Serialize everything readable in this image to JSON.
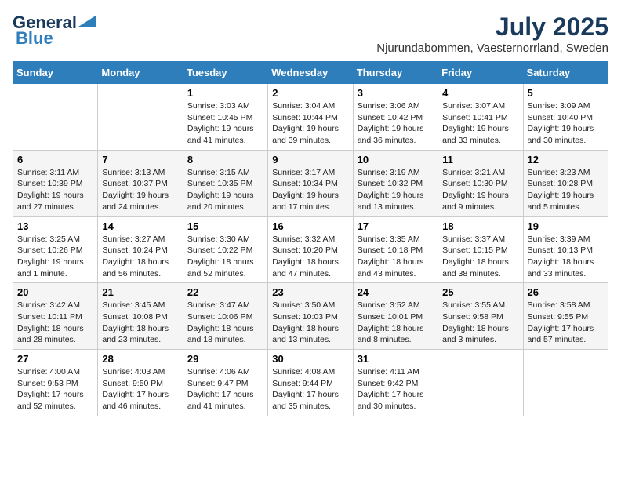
{
  "header": {
    "logo_general": "General",
    "logo_blue": "Blue",
    "month": "July 2025",
    "location": "Njurundabommen, Vaesternorrland, Sweden"
  },
  "days_of_week": [
    "Sunday",
    "Monday",
    "Tuesday",
    "Wednesday",
    "Thursday",
    "Friday",
    "Saturday"
  ],
  "weeks": [
    [
      {
        "day": "",
        "info": ""
      },
      {
        "day": "",
        "info": ""
      },
      {
        "day": "1",
        "info": "Sunrise: 3:03 AM\nSunset: 10:45 PM\nDaylight: 19 hours and 41 minutes."
      },
      {
        "day": "2",
        "info": "Sunrise: 3:04 AM\nSunset: 10:44 PM\nDaylight: 19 hours and 39 minutes."
      },
      {
        "day": "3",
        "info": "Sunrise: 3:06 AM\nSunset: 10:42 PM\nDaylight: 19 hours and 36 minutes."
      },
      {
        "day": "4",
        "info": "Sunrise: 3:07 AM\nSunset: 10:41 PM\nDaylight: 19 hours and 33 minutes."
      },
      {
        "day": "5",
        "info": "Sunrise: 3:09 AM\nSunset: 10:40 PM\nDaylight: 19 hours and 30 minutes."
      }
    ],
    [
      {
        "day": "6",
        "info": "Sunrise: 3:11 AM\nSunset: 10:39 PM\nDaylight: 19 hours and 27 minutes."
      },
      {
        "day": "7",
        "info": "Sunrise: 3:13 AM\nSunset: 10:37 PM\nDaylight: 19 hours and 24 minutes."
      },
      {
        "day": "8",
        "info": "Sunrise: 3:15 AM\nSunset: 10:35 PM\nDaylight: 19 hours and 20 minutes."
      },
      {
        "day": "9",
        "info": "Sunrise: 3:17 AM\nSunset: 10:34 PM\nDaylight: 19 hours and 17 minutes."
      },
      {
        "day": "10",
        "info": "Sunrise: 3:19 AM\nSunset: 10:32 PM\nDaylight: 19 hours and 13 minutes."
      },
      {
        "day": "11",
        "info": "Sunrise: 3:21 AM\nSunset: 10:30 PM\nDaylight: 19 hours and 9 minutes."
      },
      {
        "day": "12",
        "info": "Sunrise: 3:23 AM\nSunset: 10:28 PM\nDaylight: 19 hours and 5 minutes."
      }
    ],
    [
      {
        "day": "13",
        "info": "Sunrise: 3:25 AM\nSunset: 10:26 PM\nDaylight: 19 hours and 1 minute."
      },
      {
        "day": "14",
        "info": "Sunrise: 3:27 AM\nSunset: 10:24 PM\nDaylight: 18 hours and 56 minutes."
      },
      {
        "day": "15",
        "info": "Sunrise: 3:30 AM\nSunset: 10:22 PM\nDaylight: 18 hours and 52 minutes."
      },
      {
        "day": "16",
        "info": "Sunrise: 3:32 AM\nSunset: 10:20 PM\nDaylight: 18 hours and 47 minutes."
      },
      {
        "day": "17",
        "info": "Sunrise: 3:35 AM\nSunset: 10:18 PM\nDaylight: 18 hours and 43 minutes."
      },
      {
        "day": "18",
        "info": "Sunrise: 3:37 AM\nSunset: 10:15 PM\nDaylight: 18 hours and 38 minutes."
      },
      {
        "day": "19",
        "info": "Sunrise: 3:39 AM\nSunset: 10:13 PM\nDaylight: 18 hours and 33 minutes."
      }
    ],
    [
      {
        "day": "20",
        "info": "Sunrise: 3:42 AM\nSunset: 10:11 PM\nDaylight: 18 hours and 28 minutes."
      },
      {
        "day": "21",
        "info": "Sunrise: 3:45 AM\nSunset: 10:08 PM\nDaylight: 18 hours and 23 minutes."
      },
      {
        "day": "22",
        "info": "Sunrise: 3:47 AM\nSunset: 10:06 PM\nDaylight: 18 hours and 18 minutes."
      },
      {
        "day": "23",
        "info": "Sunrise: 3:50 AM\nSunset: 10:03 PM\nDaylight: 18 hours and 13 minutes."
      },
      {
        "day": "24",
        "info": "Sunrise: 3:52 AM\nSunset: 10:01 PM\nDaylight: 18 hours and 8 minutes."
      },
      {
        "day": "25",
        "info": "Sunrise: 3:55 AM\nSunset: 9:58 PM\nDaylight: 18 hours and 3 minutes."
      },
      {
        "day": "26",
        "info": "Sunrise: 3:58 AM\nSunset: 9:55 PM\nDaylight: 17 hours and 57 minutes."
      }
    ],
    [
      {
        "day": "27",
        "info": "Sunrise: 4:00 AM\nSunset: 9:53 PM\nDaylight: 17 hours and 52 minutes."
      },
      {
        "day": "28",
        "info": "Sunrise: 4:03 AM\nSunset: 9:50 PM\nDaylight: 17 hours and 46 minutes."
      },
      {
        "day": "29",
        "info": "Sunrise: 4:06 AM\nSunset: 9:47 PM\nDaylight: 17 hours and 41 minutes."
      },
      {
        "day": "30",
        "info": "Sunrise: 4:08 AM\nSunset: 9:44 PM\nDaylight: 17 hours and 35 minutes."
      },
      {
        "day": "31",
        "info": "Sunrise: 4:11 AM\nSunset: 9:42 PM\nDaylight: 17 hours and 30 minutes."
      },
      {
        "day": "",
        "info": ""
      },
      {
        "day": "",
        "info": ""
      }
    ]
  ]
}
